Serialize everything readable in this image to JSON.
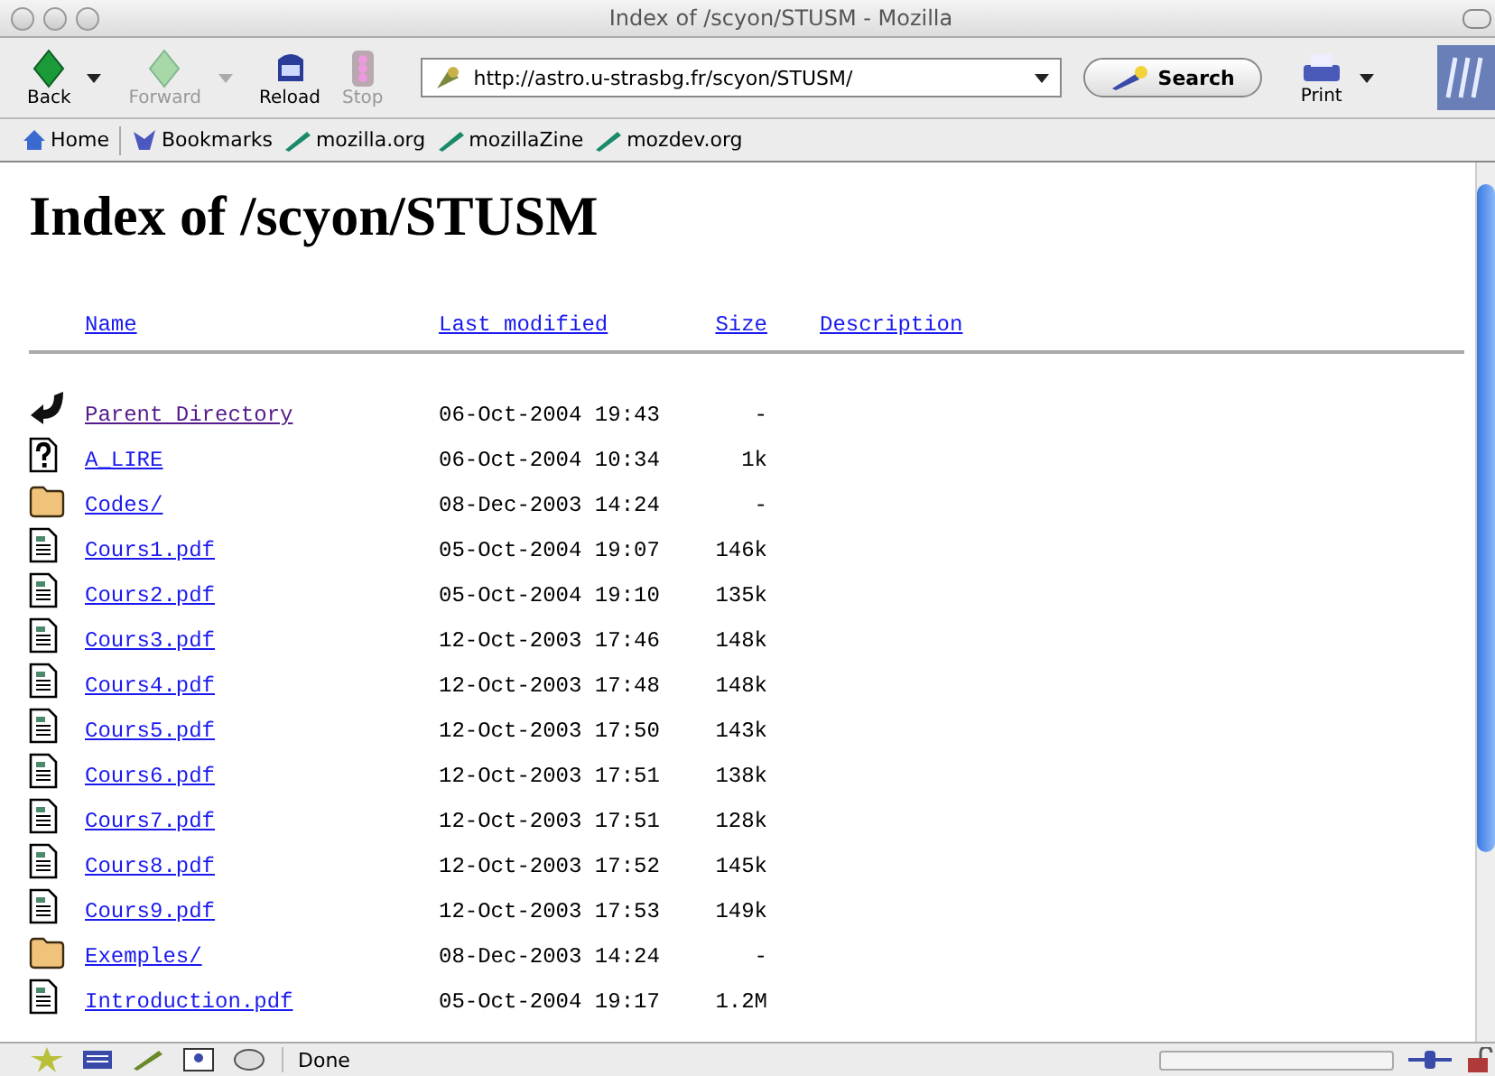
{
  "window": {
    "title": "Index of /scyon/STUSM - Mozilla"
  },
  "toolbar": {
    "buttons": [
      {
        "label": "Back",
        "kind": "back",
        "disabled": false
      },
      {
        "label": "Forward",
        "kind": "forward",
        "disabled": true
      },
      {
        "label": "Reload",
        "kind": "reload",
        "disabled": false
      },
      {
        "label": "Stop",
        "kind": "stop",
        "disabled": true
      }
    ],
    "address": "http://astro.u-strasbg.fr/scyon/STUSM/",
    "search": "Search",
    "print": "Print"
  },
  "bookmarks": [
    {
      "label": "Home",
      "kind": "home"
    },
    {
      "label": "Bookmarks",
      "kind": "bookmarks"
    },
    {
      "label": "mozilla.org",
      "kind": "link"
    },
    {
      "label": "mozillaZine",
      "kind": "link"
    },
    {
      "label": "mozdev.org",
      "kind": "link"
    }
  ],
  "page": {
    "heading": "Index of /scyon/STUSM",
    "columns": [
      "Name",
      "Last modified",
      "Size",
      "Description"
    ],
    "rows": [
      {
        "kind": "parent",
        "name": "Parent Directory",
        "visited": true,
        "modified": "06-Oct-2004 19:43",
        "size": "-"
      },
      {
        "kind": "unknown",
        "name": "A_LIRE",
        "visited": false,
        "modified": "06-Oct-2004 10:34",
        "size": "1k"
      },
      {
        "kind": "folder",
        "name": "Codes/",
        "visited": false,
        "modified": "08-Dec-2003 14:24",
        "size": "-"
      },
      {
        "kind": "document",
        "name": "Cours1.pdf",
        "visited": false,
        "modified": "05-Oct-2004 19:07",
        "size": "146k"
      },
      {
        "kind": "document",
        "name": "Cours2.pdf",
        "visited": false,
        "modified": "05-Oct-2004 19:10",
        "size": "135k"
      },
      {
        "kind": "document",
        "name": "Cours3.pdf",
        "visited": false,
        "modified": "12-Oct-2003 17:46",
        "size": "148k"
      },
      {
        "kind": "document",
        "name": "Cours4.pdf",
        "visited": false,
        "modified": "12-Oct-2003 17:48",
        "size": "148k"
      },
      {
        "kind": "document",
        "name": "Cours5.pdf",
        "visited": false,
        "modified": "12-Oct-2003 17:50",
        "size": "143k"
      },
      {
        "kind": "document",
        "name": "Cours6.pdf",
        "visited": false,
        "modified": "12-Oct-2003 17:51",
        "size": "138k"
      },
      {
        "kind": "document",
        "name": "Cours7.pdf",
        "visited": false,
        "modified": "12-Oct-2003 17:51",
        "size": "128k"
      },
      {
        "kind": "document",
        "name": "Cours8.pdf",
        "visited": false,
        "modified": "12-Oct-2003 17:52",
        "size": "145k"
      },
      {
        "kind": "document",
        "name": "Cours9.pdf",
        "visited": false,
        "modified": "12-Oct-2003 17:53",
        "size": "149k"
      },
      {
        "kind": "folder",
        "name": "Exemples/",
        "visited": false,
        "modified": "08-Dec-2003 14:24",
        "size": "-"
      },
      {
        "kind": "document",
        "name": "Introduction.pdf",
        "visited": false,
        "modified": "05-Oct-2004 19:17",
        "size": "1.2M"
      }
    ]
  },
  "status_bar": {
    "text": "Done"
  }
}
